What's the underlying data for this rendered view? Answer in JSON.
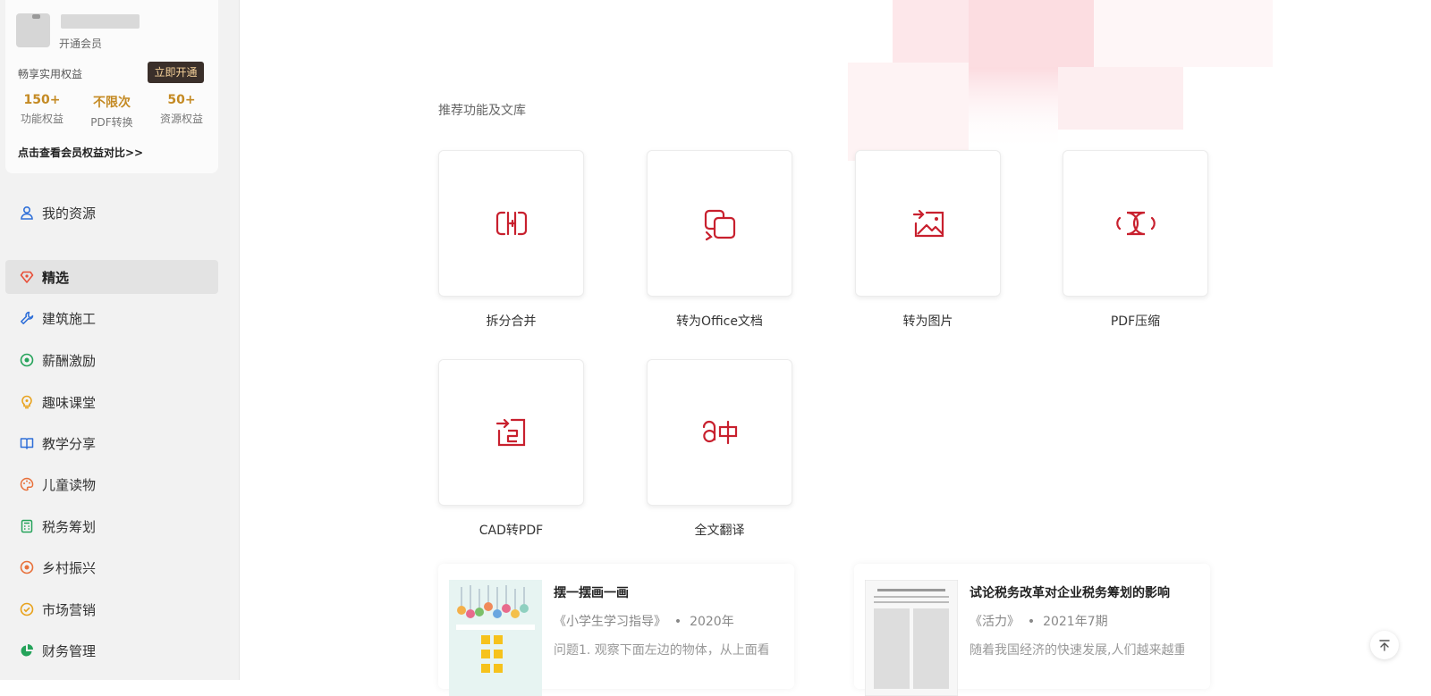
{
  "vip_card": {
    "open_vip": "开通会员",
    "benefit_label": "畅享实用权益",
    "open_now": "立即开通",
    "stats": [
      {
        "value": "150+",
        "label": "功能权益"
      },
      {
        "value": "不限次",
        "label": "PDF转换"
      },
      {
        "value": "50+",
        "label": "资源权益"
      }
    ],
    "compare_link": "点击查看会员权益对比>>"
  },
  "sidebar": {
    "my_resources": "我的资源",
    "items": [
      {
        "label": "精选",
        "icon": "diamond-icon",
        "color": "#e8503a"
      },
      {
        "label": "建筑施工",
        "icon": "wrench-icon",
        "color": "#2f6fd8"
      },
      {
        "label": "薪酬激励",
        "icon": "coin-icon",
        "color": "#25a35a"
      },
      {
        "label": "趣味课堂",
        "icon": "lightbulb-icon",
        "color": "#e8a21c"
      },
      {
        "label": "教学分享",
        "icon": "book-icon",
        "color": "#2f6fd8"
      },
      {
        "label": "儿童读物",
        "icon": "palette-icon",
        "color": "#e8703a"
      },
      {
        "label": "税务筹划",
        "icon": "calculator-icon",
        "color": "#25a35a"
      },
      {
        "label": "乡村振兴",
        "icon": "target-icon",
        "color": "#e8703a"
      },
      {
        "label": "市场营销",
        "icon": "check-badge-icon",
        "color": "#e8a21c"
      },
      {
        "label": "财务管理",
        "icon": "pie-chart-icon",
        "color": "#25a35a"
      }
    ]
  },
  "main": {
    "section_title": "推荐功能及文库",
    "accent_color": "#c8202e",
    "tools": [
      {
        "label": "拆分合并",
        "icon": "split-merge-icon"
      },
      {
        "label": "转为Office文档",
        "icon": "convert-office-icon"
      },
      {
        "label": "转为图片",
        "icon": "convert-image-icon"
      },
      {
        "label": "PDF压缩",
        "icon": "compress-icon"
      },
      {
        "label": "CAD转PDF",
        "icon": "cad-convert-icon"
      },
      {
        "label": "全文翻译",
        "icon": "translate-icon"
      }
    ],
    "documents": [
      {
        "title": "摆一摆画一画",
        "source": "《小学生学习指导》",
        "date": "2020年",
        "excerpt": "问题1. 观察下面左边的物体，从上面看"
      },
      {
        "title": "试论税务改革对企业税务筹划的影响",
        "source": "《活力》",
        "date": "2021年7期",
        "excerpt": "随着我国经济的快速发展,人们越来越重视"
      }
    ]
  }
}
